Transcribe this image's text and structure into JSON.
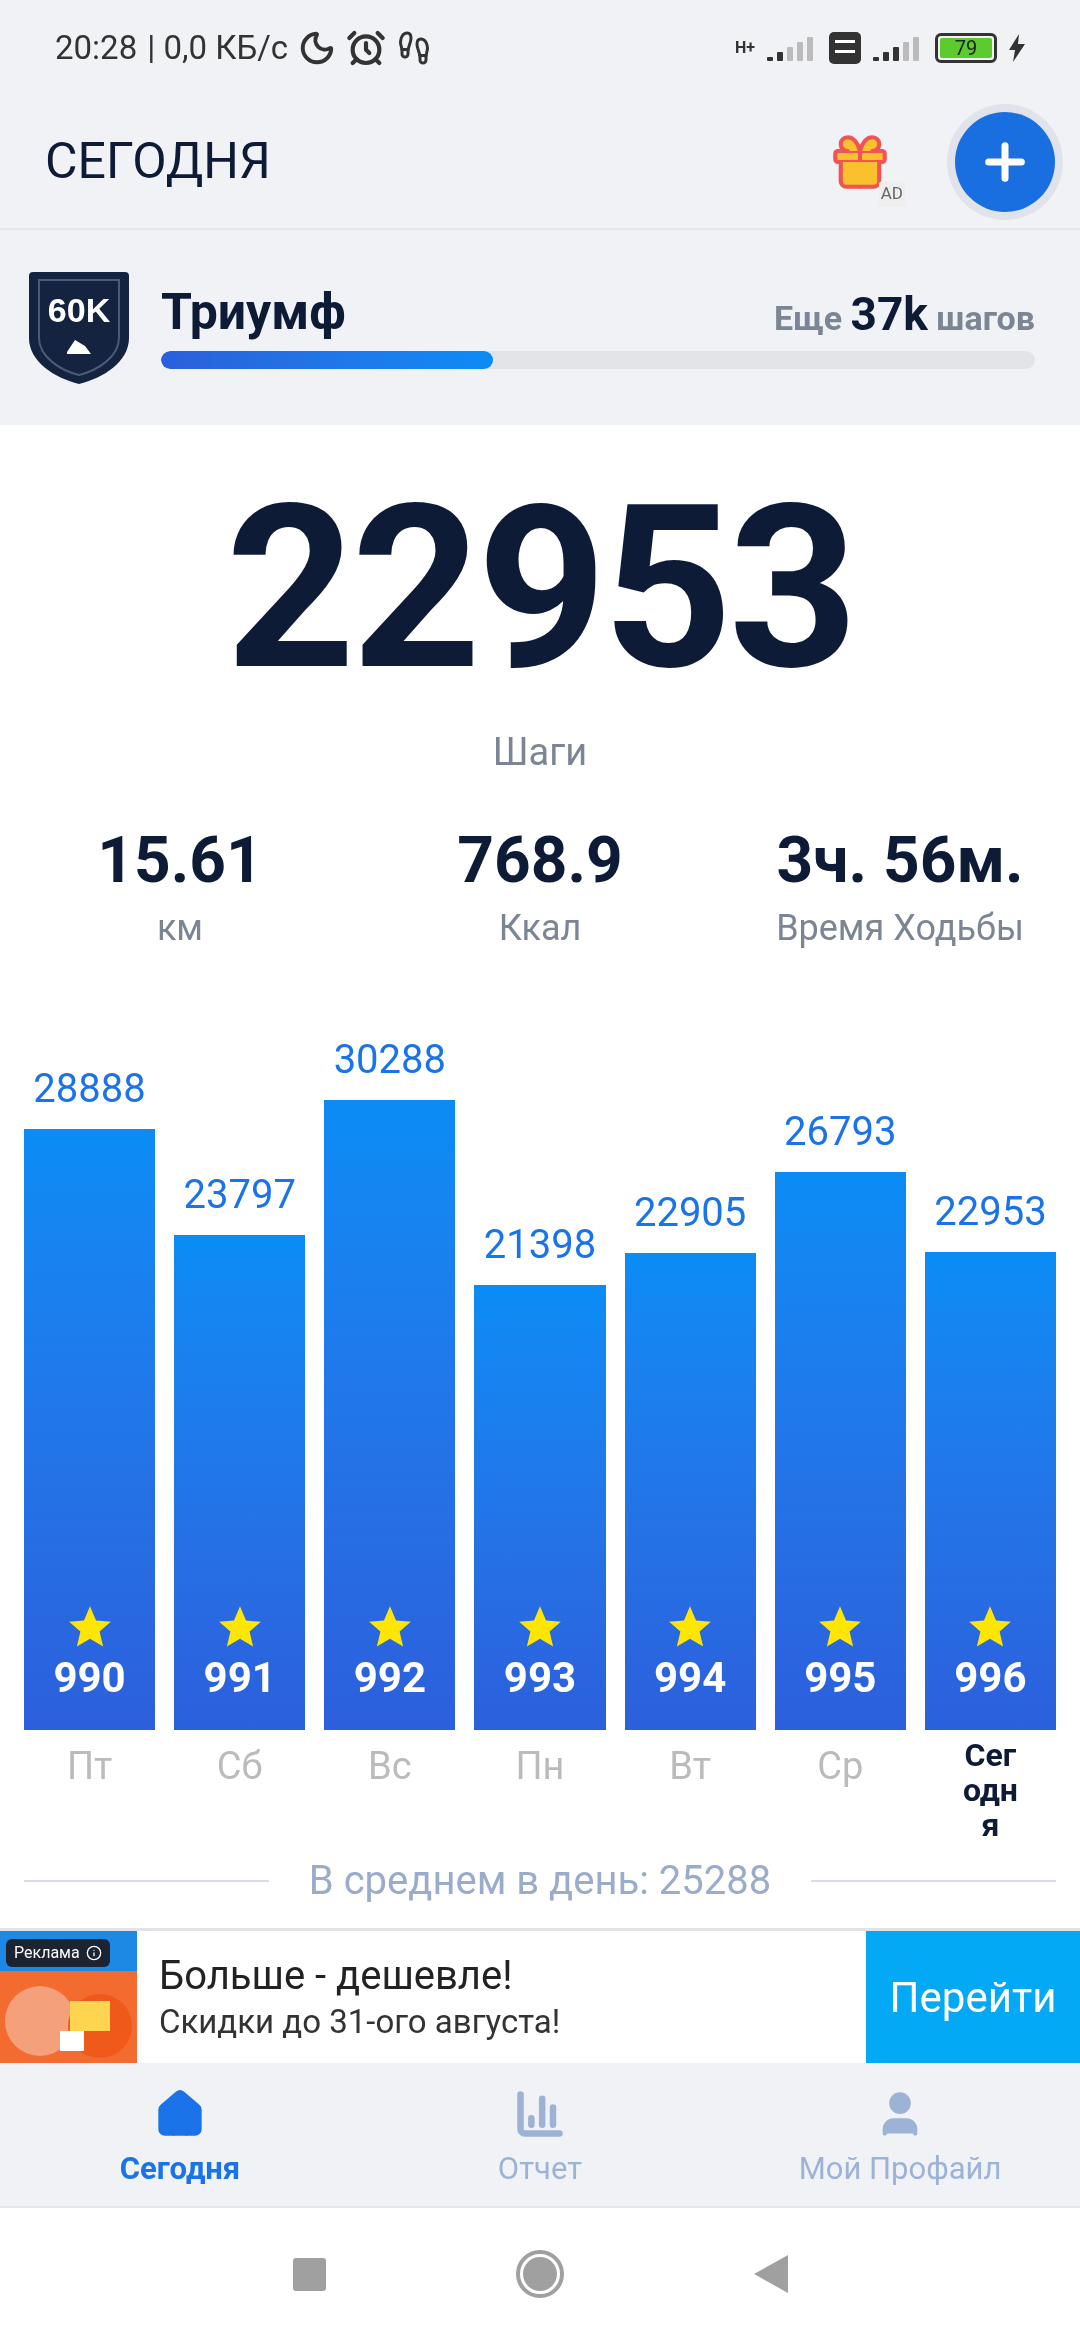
{
  "status_bar": {
    "time": "20:28",
    "speed": "| 0,0 КБ/с",
    "network": "H+",
    "battery": "79"
  },
  "header": {
    "title": "СЕГОДНЯ",
    "gift_badge": "AD"
  },
  "achievement": {
    "badge": "60K",
    "title": "Триумф",
    "remaining_prefix": "Еще",
    "remaining_value": "37k",
    "remaining_suffix": "шагов",
    "level": 0.38
  },
  "steps": {
    "value": "22953",
    "label": "Шаги"
  },
  "stats": [
    {
      "value": "15.61",
      "label": "км"
    },
    {
      "value": "768.9",
      "label": "Ккал"
    },
    {
      "value": "3ч. 56м.",
      "label": "Время Ходьбы"
    }
  ],
  "chart_data": {
    "type": "bar",
    "categories": [
      "Пт",
      "Сб",
      "Вс",
      "Пн",
      "Вт",
      "Ср",
      "Сегодня"
    ],
    "values": [
      28888,
      23797,
      30288,
      21398,
      22905,
      26793,
      22953
    ],
    "data_labels": true
  },
  "bars": [
    {
      "badge": "990",
      "selected": false
    },
    {
      "badge": "991",
      "selected": false
    },
    {
      "badge": "992",
      "selected": false
    },
    {
      "badge": "993",
      "selected": false
    },
    {
      "badge": "994",
      "selected": false
    },
    {
      "badge": "995",
      "selected": false
    },
    {
      "badge": "996",
      "selected": true
    }
  ],
  "average": "В среднем в день: 25288",
  "ad": {
    "tag": "Реклама",
    "title": "Больше - дешевле!",
    "subtitle": "Скидки до 31-ого августа!",
    "button": "Перейти"
  },
  "bottom_nav": [
    {
      "label": "Сегодня",
      "selected": true,
      "kind": "home"
    },
    {
      "label": "Отчет",
      "selected": false,
      "kind": "report"
    },
    {
      "label": "Мой Профайл",
      "selected": false,
      "kind": "profile"
    }
  ]
}
